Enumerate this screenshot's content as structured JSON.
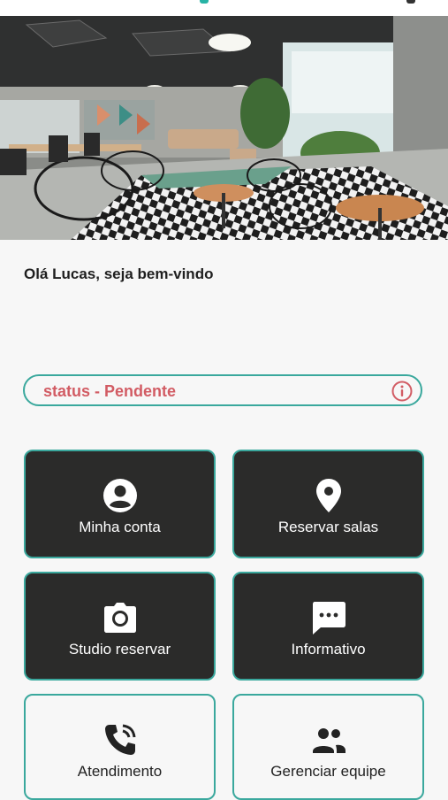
{
  "greeting": "Olá Lucas, seja bem-vindo",
  "status": {
    "text": "status - Pendente",
    "icon": "info-circle-icon",
    "color": "#d25c64",
    "border_color": "#3aa89d"
  },
  "menu": [
    {
      "label": "Minha conta",
      "icon": "account-circle-icon",
      "style": "dark"
    },
    {
      "label": "Reservar salas",
      "icon": "location-pin-icon",
      "style": "dark"
    },
    {
      "label": "Studio reservar",
      "icon": "camera-icon",
      "style": "dark"
    },
    {
      "label": "Informativo",
      "icon": "chat-bubble-icon",
      "style": "dark"
    },
    {
      "label": "Atendimento",
      "icon": "phone-call-icon",
      "style": "light"
    },
    {
      "label": "Gerenciar equipe",
      "icon": "team-icon",
      "style": "light"
    }
  ],
  "colors": {
    "accent": "#3aa89d",
    "tile_dark": "#2b2b2a",
    "background": "#f7f7f7"
  }
}
